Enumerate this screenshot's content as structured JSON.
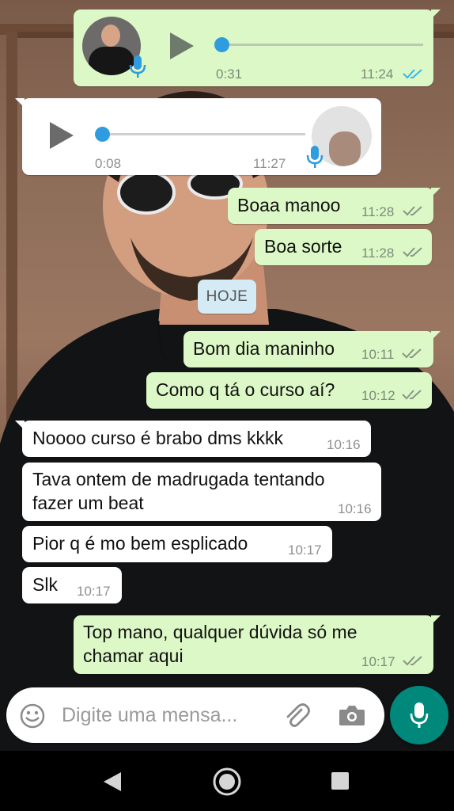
{
  "messages": {
    "audio1": {
      "duration": "0:31",
      "time": "11:24"
    },
    "audio2": {
      "duration": "0:08",
      "time": "11:27"
    },
    "m1": {
      "text": "Boaa manoo",
      "time": "11:28"
    },
    "m2": {
      "text": "Boa sorte",
      "time": "11:28"
    },
    "date_divider": "HOJE",
    "m3": {
      "text": "Bom dia maninho",
      "time": "10:11"
    },
    "m4": {
      "text": "Como q tá o curso aí?",
      "time": "10:12"
    },
    "m5": {
      "text": "Noooo curso é brabo dms kkkk",
      "time": "10:16"
    },
    "m6": {
      "line1": "Tava ontem de madrugada tentando",
      "line2": "fazer um beat",
      "time": "10:16"
    },
    "m7": {
      "text": "Pior q é mo bem esplicado",
      "time": "10:17"
    },
    "m8": {
      "text": "Slk",
      "time": "10:17"
    },
    "m9": {
      "line1": "Top mano, qualquer dúvida só me",
      "line2": "chamar aqui",
      "time": "10:17"
    }
  },
  "composer": {
    "placeholder": "Digite uma mensa..."
  },
  "icons": {
    "emoji": "emoji-icon",
    "attach": "paperclip-icon",
    "camera": "camera-icon",
    "mic": "mic-icon",
    "back": "back-triangle-icon",
    "home": "home-circle-icon",
    "recents": "recents-square-icon"
  },
  "colors": {
    "outgoing": "#dcf8c6",
    "incoming": "#ffffff",
    "accent": "#00897b",
    "read_ticks": "#34b7f1",
    "audio_dot": "#2f9ce0"
  }
}
